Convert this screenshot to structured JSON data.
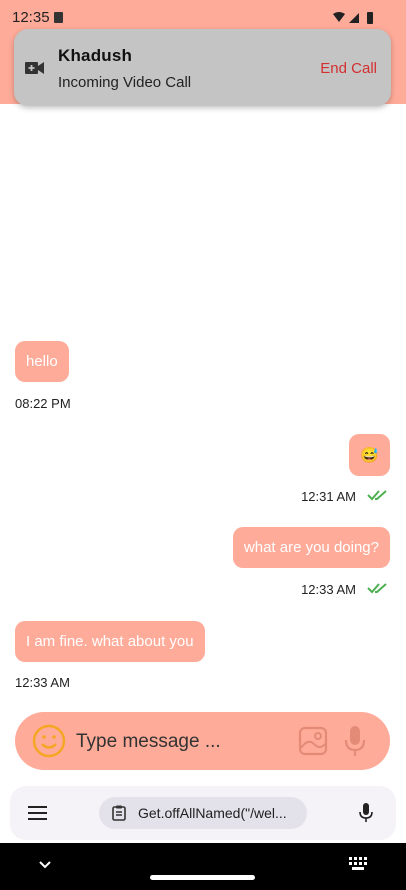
{
  "status_bar": {
    "time": "12:35"
  },
  "call_notification": {
    "caller": "Khadush",
    "subtitle": "Incoming Video Call",
    "action": "End Call"
  },
  "messages": [
    {
      "text": "hello",
      "time": "08:22 PM",
      "direction": "incoming"
    },
    {
      "text": "😅",
      "time": "12:31 AM",
      "direction": "outgoing",
      "read": true
    },
    {
      "text": "what are you doing?",
      "time": "12:33 AM",
      "direction": "outgoing",
      "read": true
    },
    {
      "text": "I am fine. what about you",
      "time": "12:33 AM",
      "direction": "incoming"
    }
  ],
  "composer": {
    "placeholder": "Type message ..."
  },
  "keyboard_bar": {
    "clipboard_text": "Get.offAllNamed(\"/wel..."
  },
  "colors": {
    "accent": "#ffab99",
    "end_call": "#d32f2f",
    "read_ticks": "#4caf50"
  }
}
